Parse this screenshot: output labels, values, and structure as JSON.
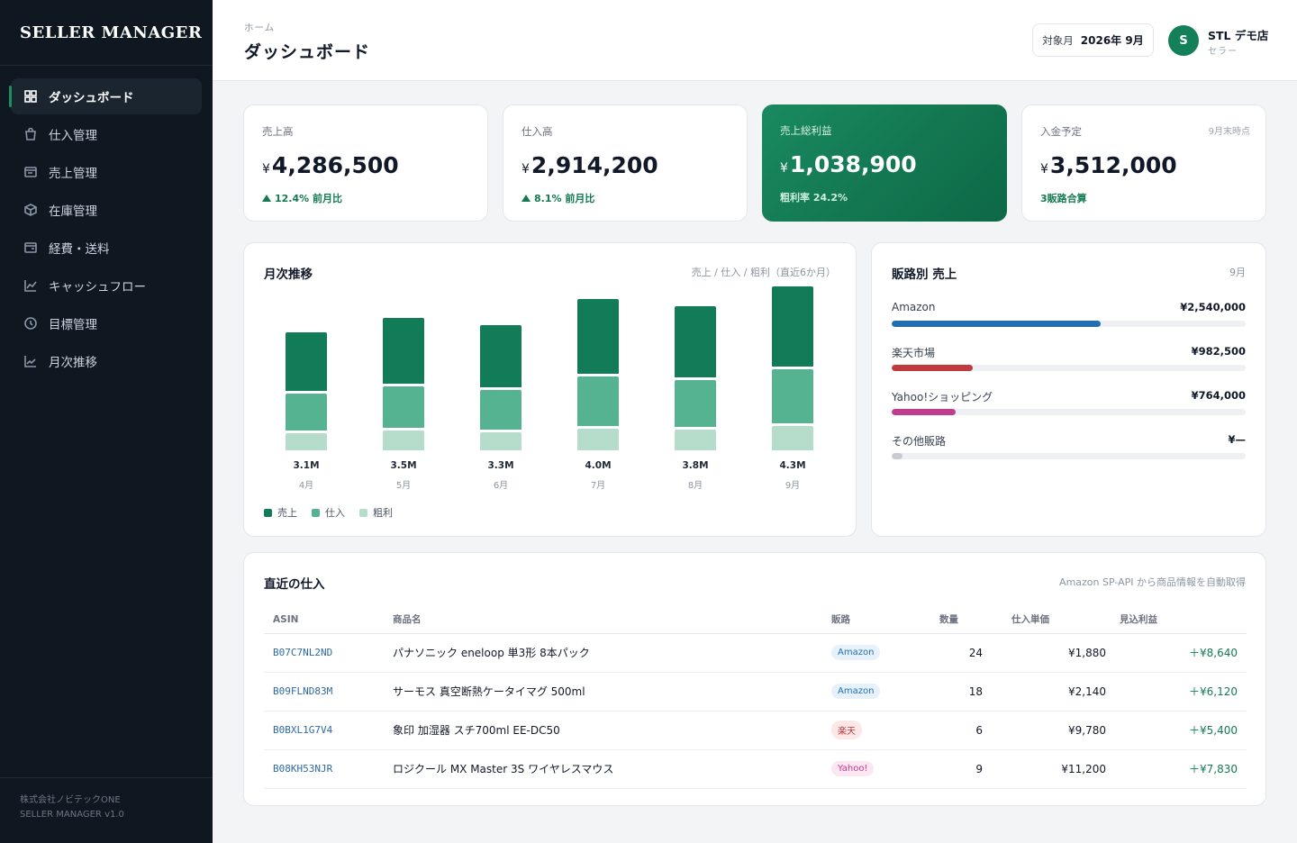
{
  "app": {
    "brand": "SELLER MANAGER",
    "footer_line1": "株式会社ノビテックONE",
    "footer_line2": "SELLER MANAGER v1.0"
  },
  "sidebar": {
    "items": [
      {
        "label": "ダッシュボード",
        "icon": "dashboard-icon",
        "active": true
      },
      {
        "label": "仕入管理",
        "icon": "shopping-bag-icon",
        "active": false
      },
      {
        "label": "売上管理",
        "icon": "receipt-icon",
        "active": false
      },
      {
        "label": "在庫管理",
        "icon": "box-icon",
        "active": false
      },
      {
        "label": "経費・送料",
        "icon": "wallet-icon",
        "active": false
      },
      {
        "label": "キャッシュフロー",
        "icon": "line-chart-icon",
        "active": false
      },
      {
        "label": "目標管理",
        "icon": "clock-icon",
        "active": false
      },
      {
        "label": "月次推移",
        "icon": "trend-icon",
        "active": false
      }
    ]
  },
  "header": {
    "breadcrumb": "ホーム",
    "title": "ダッシュボード",
    "month_label": "対象月",
    "month_value": "2026年 9月",
    "avatar_initial": "S",
    "user_name": "STL デモ店",
    "user_role": "セラー"
  },
  "kpis": [
    {
      "label": "売上高",
      "yen": "¥",
      "value": "4,286,500",
      "delta": "12.4% 前月比",
      "note": ""
    },
    {
      "label": "仕入高",
      "yen": "¥",
      "value": "2,914,200",
      "delta": "8.1% 前月比",
      "note": ""
    },
    {
      "label": "売上総利益",
      "yen": "¥",
      "value": "1,038,900",
      "delta": "粗利率 24.2%",
      "note": ""
    },
    {
      "label": "入金予定",
      "yen": "¥",
      "value": "3,512,000",
      "delta": "3販路合算",
      "note": "9月末時点"
    }
  ],
  "monthly": {
    "title": "月次推移",
    "note": "売上 / 仕入 / 粗利（直近6か月）",
    "legend": [
      "売上",
      "仕入",
      "粗利"
    ]
  },
  "chart_data": {
    "type": "bar",
    "categories": [
      "4月",
      "5月",
      "6月",
      "7月",
      "8月",
      "9月"
    ],
    "data_labels": [
      "3.1M",
      "3.5M",
      "3.3M",
      "4.0M",
      "3.8M",
      "4.3M"
    ],
    "series": [
      {
        "name": "売上",
        "values": [
          3.1,
          3.5,
          3.3,
          4.0,
          3.8,
          4.3
        ]
      },
      {
        "name": "仕入",
        "values": [
          1.6,
          1.8,
          1.7,
          2.1,
          2.0,
          2.3
        ]
      },
      {
        "name": "粗利",
        "values": [
          0.7,
          0.8,
          0.75,
          0.9,
          0.85,
          1.0
        ]
      }
    ],
    "colors": [
      "#127c58",
      "#56b391",
      "#b6ddcc"
    ]
  },
  "channels": {
    "title": "販路別 売上",
    "note": "9月",
    "items": [
      {
        "name": "Amazon",
        "value": "¥2,540,000",
        "share": 0.59,
        "color": "#1f6fb2"
      },
      {
        "name": "楽天市場",
        "value": "¥982,500",
        "share": 0.23,
        "color": "#c0393b"
      },
      {
        "name": "Yahoo!ショッピング",
        "value": "¥764,000",
        "share": 0.18,
        "color": "#c23c8e"
      },
      {
        "name": "その他販路",
        "value": "¥—",
        "share": 0.03,
        "color": "#c8ccd2"
      }
    ]
  },
  "purchases": {
    "title": "直近の仕入",
    "note": "Amazon SP-API から商品情報を自動取得",
    "columns": [
      "ASIN",
      "商品名",
      "販路",
      "数量",
      "仕入単価",
      "見込利益"
    ],
    "rows": [
      {
        "asin": "B07C7NL2ND",
        "name": "パナソニック eneloop 単3形 8本パック",
        "channel": "Amazon",
        "qty": "24",
        "unit_price": "¥1,880",
        "profit": "＋¥8,640"
      },
      {
        "asin": "B09FLND83M",
        "name": "サーモス 真空断熱ケータイマグ 500ml",
        "channel": "Amazon",
        "qty": "18",
        "unit_price": "¥2,140",
        "profit": "＋¥6,120"
      },
      {
        "asin": "B0BXL1G7V4",
        "name": "象印 加湿器 スチ700ml EE-DC50",
        "channel": "楽天",
        "qty": "6",
        "unit_price": "¥9,780",
        "profit": "＋¥5,400"
      },
      {
        "asin": "B08KH53NJR",
        "name": "ロジクール MX Master 3S ワイヤレスマウス",
        "channel": "Yahoo!",
        "qty": "9",
        "unit_price": "¥11,200",
        "profit": "＋¥7,830"
      }
    ]
  },
  "pill_colors": {
    "Amazon": {
      "bg": "#e6f1fb",
      "fg": "#1f6fb2"
    },
    "楽天": {
      "bg": "#fde8e8",
      "fg": "#c0393b"
    },
    "Yahoo!": {
      "bg": "#fbe6f1",
      "fg": "#c23c8e"
    }
  }
}
